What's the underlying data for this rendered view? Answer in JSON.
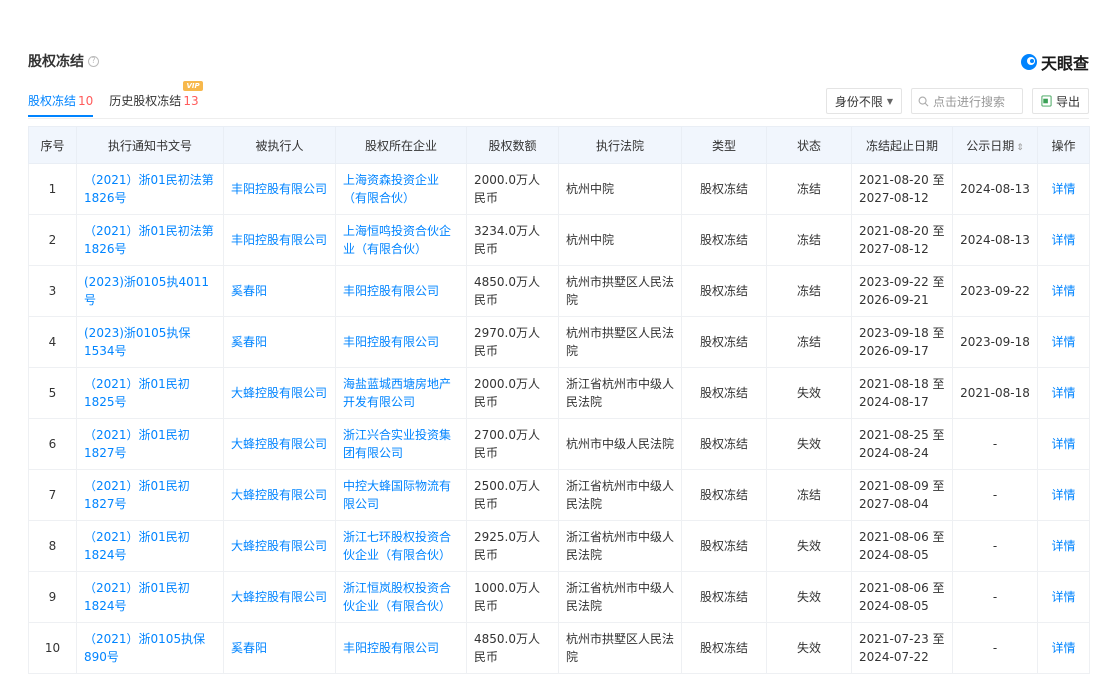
{
  "header": {
    "title": "股权冻结",
    "logo_text": "天眼查"
  },
  "tabs": [
    {
      "label": "股权冻结",
      "count": "10",
      "vip": ""
    },
    {
      "label": "历史股权冻结",
      "count": "13",
      "vip": "VIP"
    }
  ],
  "toolbar": {
    "filter_label": "身份不限",
    "search_placeholder": "点击进行搜索",
    "export_label": "导出"
  },
  "table": {
    "columns": [
      "序号",
      "执行通知书文号",
      "被执行人",
      "股权所在企业",
      "股权数额",
      "执行法院",
      "类型",
      "状态",
      "冻结起止日期",
      "公示日期",
      "操作"
    ],
    "rows": [
      {
        "no": "1",
        "doc": "（2021）浙01民初法第1826号",
        "person": "丰阳控股有限公司",
        "company": "上海资森投资企业（有限合伙）",
        "amount": "2000.0万人民币",
        "court": "杭州中院",
        "type": "股权冻结",
        "status": "冻结",
        "range": "2021-08-20 至 2027-08-12",
        "pub": "2024-08-13",
        "op": "详情"
      },
      {
        "no": "2",
        "doc": "（2021）浙01民初法第1826号",
        "person": "丰阳控股有限公司",
        "company": "上海恒鸣投资合伙企业（有限合伙）",
        "amount": "3234.0万人民币",
        "court": "杭州中院",
        "type": "股权冻结",
        "status": "冻结",
        "range": "2021-08-20 至 2027-08-12",
        "pub": "2024-08-13",
        "op": "详情"
      },
      {
        "no": "3",
        "doc": "(2023)浙0105执4011号",
        "person": "奚春阳",
        "company": "丰阳控股有限公司",
        "amount": "4850.0万人民币",
        "court": "杭州市拱墅区人民法院",
        "type": "股权冻结",
        "status": "冻结",
        "range": "2023-09-22 至 2026-09-21",
        "pub": "2023-09-22",
        "op": "详情"
      },
      {
        "no": "4",
        "doc": "(2023)浙0105执保1534号",
        "person": "奚春阳",
        "company": "丰阳控股有限公司",
        "amount": "2970.0万人民币",
        "court": "杭州市拱墅区人民法院",
        "type": "股权冻结",
        "status": "冻结",
        "range": "2023-09-18 至 2026-09-17",
        "pub": "2023-09-18",
        "op": "详情"
      },
      {
        "no": "5",
        "doc": "（2021）浙01民初1825号",
        "person": "大蜂控股有限公司",
        "company": "海盐蓝城西塘房地产开发有限公司",
        "amount": "2000.0万人民币",
        "court": "浙江省杭州市中级人民法院",
        "type": "股权冻结",
        "status": "失效",
        "range": "2021-08-18 至 2024-08-17",
        "pub": "2021-08-18",
        "op": "详情"
      },
      {
        "no": "6",
        "doc": "（2021）浙01民初1827号",
        "person": "大蜂控股有限公司",
        "company": "浙江兴合实业投资集团有限公司",
        "amount": "2700.0万人民币",
        "court": "杭州市中级人民法院",
        "type": "股权冻结",
        "status": "失效",
        "range": "2021-08-25 至 2024-08-24",
        "pub": "-",
        "op": "详情"
      },
      {
        "no": "7",
        "doc": "（2021）浙01民初1827号",
        "person": "大蜂控股有限公司",
        "company": "中控大蜂国际物流有限公司",
        "amount": "2500.0万人民币",
        "court": "浙江省杭州市中级人民法院",
        "type": "股权冻结",
        "status": "冻结",
        "range": "2021-08-09 至 2027-08-04",
        "pub": "-",
        "op": "详情"
      },
      {
        "no": "8",
        "doc": "（2021）浙01民初1824号",
        "person": "大蜂控股有限公司",
        "company": "浙江七环股权投资合伙企业（有限合伙）",
        "amount": "2925.0万人民币",
        "court": "浙江省杭州市中级人民法院",
        "type": "股权冻结",
        "status": "失效",
        "range": "2021-08-06 至 2024-08-05",
        "pub": "-",
        "op": "详情"
      },
      {
        "no": "9",
        "doc": "（2021）浙01民初1824号",
        "person": "大蜂控股有限公司",
        "company": "浙江恒岚股权投资合伙企业（有限合伙）",
        "amount": "1000.0万人民币",
        "court": "浙江省杭州市中级人民法院",
        "type": "股权冻结",
        "status": "失效",
        "range": "2021-08-06 至 2024-08-05",
        "pub": "-",
        "op": "详情"
      },
      {
        "no": "10",
        "doc": "（2021）浙0105执保890号",
        "person": "奚春阳",
        "company": "丰阳控股有限公司",
        "amount": "4850.0万人民币",
        "court": "杭州市拱墅区人民法院",
        "type": "股权冻结",
        "status": "失效",
        "range": "2021-07-23 至 2024-07-22",
        "pub": "-",
        "op": "详情"
      }
    ]
  }
}
